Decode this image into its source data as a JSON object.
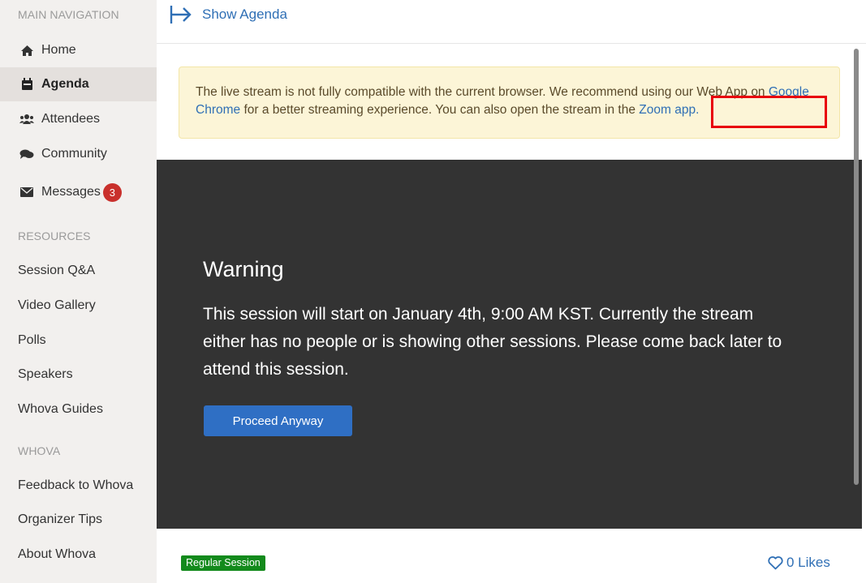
{
  "sidebar": {
    "main_nav_header": "MAIN NAVIGATION",
    "nav_items": [
      {
        "label": "Home",
        "icon": "home-icon"
      },
      {
        "label": "Agenda",
        "icon": "calendar-icon",
        "active": true
      },
      {
        "label": "Attendees",
        "icon": "users-icon"
      },
      {
        "label": "Community",
        "icon": "comments-icon"
      },
      {
        "label": "Messages",
        "icon": "envelope-icon",
        "badge": "3"
      }
    ],
    "resources_header": "RESOURCES",
    "resources": [
      "Session Q&A",
      "Video Gallery",
      "Polls",
      "Speakers",
      "Whova Guides"
    ],
    "whova_header": "WHOVA",
    "whova_items": [
      "Feedback to Whova",
      "Organizer Tips",
      "About Whova"
    ]
  },
  "topbar": {
    "show_agenda": "Show Agenda"
  },
  "alert": {
    "text_before": "The live stream is not fully compatible with the current browser. We recommend using our Web App on ",
    "chrome_link": "Google Chrome",
    "text_middle": " for a better streaming experience. You can also open the stream in the ",
    "zoom_link": "Zoom app."
  },
  "video": {
    "title": "Warning",
    "message": "This session will start on January 4th, 9:00 AM KST. Currently the stream either has no people or is showing other sessions. Please come back later to attend this session.",
    "proceed_button": "Proceed Anyway"
  },
  "footer": {
    "session_type": "Regular Session",
    "likes": "0 Likes"
  },
  "colors": {
    "accent": "#2f6fb5",
    "badge_red": "#c9302c",
    "session_green": "#138a1c",
    "video_bg": "#333333",
    "alert_bg": "#fcf5d7"
  }
}
